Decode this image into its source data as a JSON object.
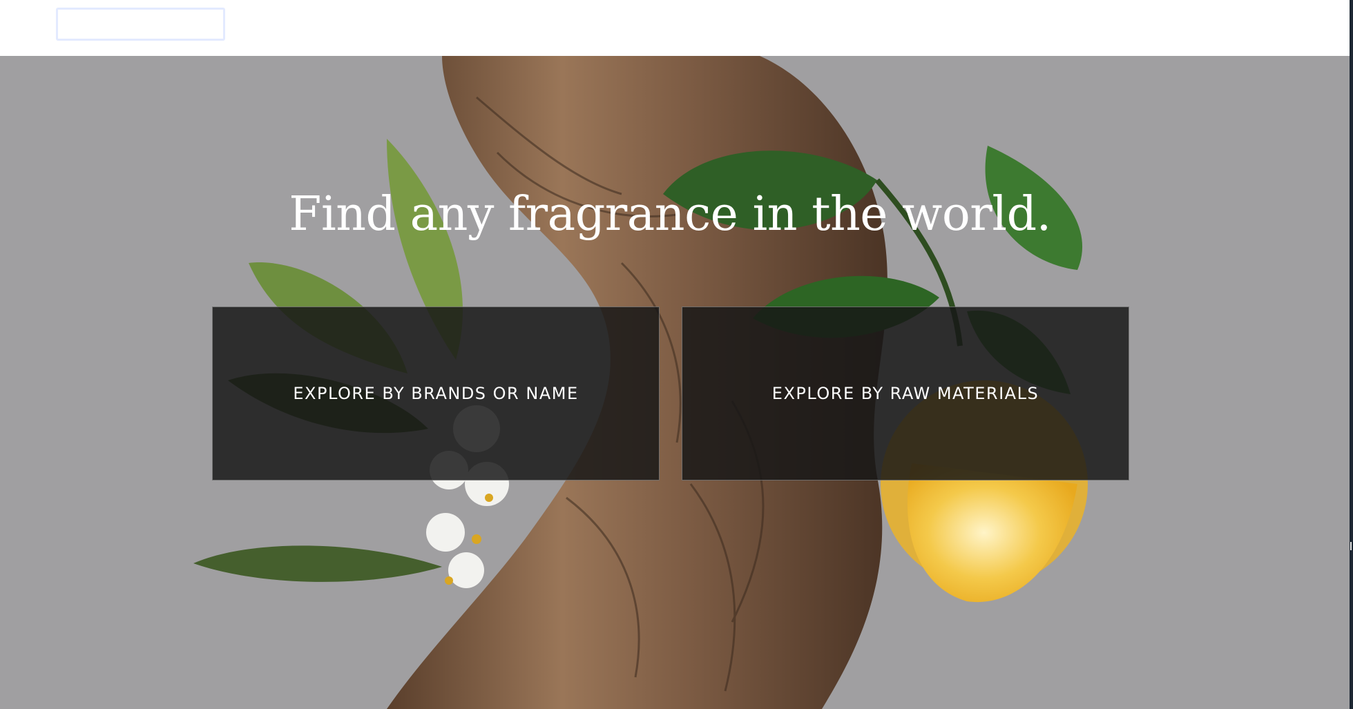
{
  "search": {
    "value": "",
    "placeholder": ""
  },
  "hero": {
    "title": "Find any fragrance in the world.",
    "buttons": [
      {
        "label": "EXPLORE BY BRANDS OR NAME"
      },
      {
        "label": "EXPLORE BY RAW MATERIALS"
      }
    ]
  },
  "colors": {
    "hero_background": "#a09fa1",
    "button_background": "#171717",
    "wood": "#8a6a4f",
    "leaf": "#3d6b2a",
    "lemon": "#f0c23a"
  }
}
